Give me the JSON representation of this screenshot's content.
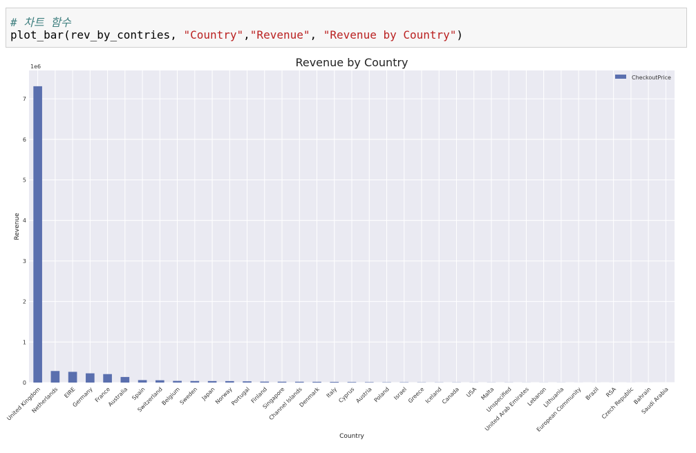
{
  "code_cell": {
    "comment": "# 차트 함수",
    "code_fn": "plot_bar(rev_by_contries, ",
    "code_arg1": "\"Country\"",
    "code_comma1": ",",
    "code_arg2": "\"Revenue\"",
    "code_comma2": ", ",
    "code_arg3": "\"Revenue by Country\"",
    "code_close": ")"
  },
  "chart_data": {
    "type": "bar",
    "title": "Revenue by Country",
    "xlabel": "Country",
    "ylabel": "Revenue",
    "y_offset_label": "1e6",
    "ylim": [
      0,
      7.7
    ],
    "yticks": [
      0,
      1,
      2,
      3,
      4,
      5,
      6,
      7
    ],
    "grid": true,
    "legend_position": "top-right",
    "bar_color": "#5a6fae",
    "background_color": "#eaeaf2",
    "categories": [
      "United Kingdom",
      "Netherlands",
      "EIRE",
      "Germany",
      "France",
      "Australia",
      "Spain",
      "Switzerland",
      "Belgium",
      "Sweden",
      "Japan",
      "Norway",
      "Portugal",
      "Finland",
      "Singapore",
      "Channel Islands",
      "Denmark",
      "Italy",
      "Cyprus",
      "Austria",
      "Poland",
      "Israel",
      "Greece",
      "Iceland",
      "Canada",
      "USA",
      "Malta",
      "Unspecified",
      "United Arab Emirates",
      "Lebanon",
      "Lithuania",
      "European Community",
      "Brazil",
      "RSA",
      "Czech Republic",
      "Bahrain",
      "Saudi Arabia"
    ],
    "series": [
      {
        "name": "CheckoutPrice",
        "values": [
          7.31,
          0.285,
          0.265,
          0.228,
          0.209,
          0.138,
          0.061,
          0.057,
          0.041,
          0.038,
          0.037,
          0.036,
          0.03,
          0.023,
          0.021,
          0.02,
          0.019,
          0.017,
          0.013,
          0.01,
          0.007,
          0.007,
          0.005,
          0.004,
          0.004,
          0.003,
          0.003,
          0.003,
          0.002,
          0.002,
          0.002,
          0.001,
          0.001,
          0.001,
          0.001,
          0.0006,
          0.0001
        ]
      }
    ]
  }
}
